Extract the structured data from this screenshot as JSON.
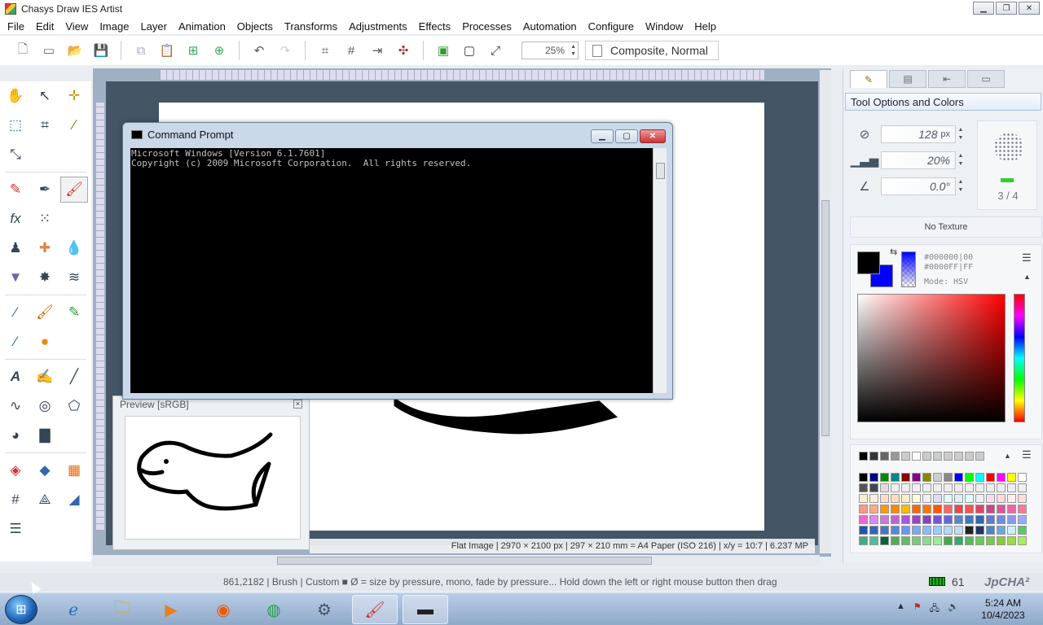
{
  "window": {
    "title": "Chasys Draw IES Artist"
  },
  "menu": [
    "File",
    "Edit",
    "View",
    "Image",
    "Layer",
    "Animation",
    "Objects",
    "Transforms",
    "Adjustments",
    "Effects",
    "Processes",
    "Automation",
    "Configure",
    "Window",
    "Help"
  ],
  "toolbar": {
    "zoom": "25%",
    "blend_mode": "Composite, Normal"
  },
  "cmd": {
    "title": "Command Prompt",
    "line1": "Microsoft Windows [Version 6.1.7601]",
    "line2": "Copyright (c) 2009 Microsoft Corporation.  All rights reserved."
  },
  "preview": {
    "title": "Preview [sRGB]"
  },
  "canvas": {
    "info": "Flat Image | 2970 × 2100 px | 297 × 210 mm = A4 Paper (ISO 216) | x/y = 10:7 | 6.237 MP"
  },
  "right_panel": {
    "header": "Tool Options and Colors",
    "size": "128",
    "size_unit": "px",
    "opacity": "20%",
    "angle": "0.0°",
    "brush_count": "3 / 4",
    "texture": "No Texture",
    "fg_hex": "#000000|00",
    "bg_hex": "#0000FF|FF",
    "color_mode": "Mode: HSV",
    "colors": {
      "foreground": "#000000",
      "background": "#0000ff"
    }
  },
  "status": {
    "text": "861,2182 | Brush | Custom ■ Ø = size by pressure, mono, fade by pressure... Hold down the left or right mouse button then drag",
    "mem_count": "61",
    "brand": "JpCHA²"
  },
  "taskbar": {
    "time": "5:24 AM",
    "date": "10/4/2023"
  }
}
